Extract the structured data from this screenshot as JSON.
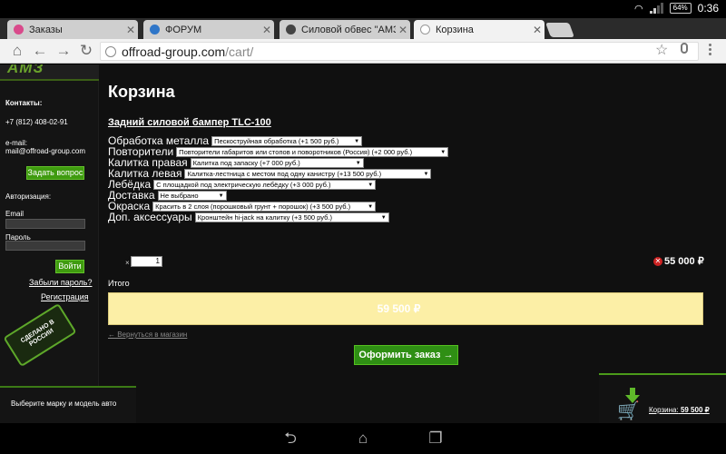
{
  "status": {
    "battery": "64%",
    "time": "0:36"
  },
  "tabs": [
    {
      "label": "Заказы",
      "icon": "tab-favicon-orders-icon",
      "color": "#d94a8b"
    },
    {
      "label": "ФОРУМ",
      "icon": "tab-favicon-forum-icon",
      "color": "#2f76c8"
    },
    {
      "label": "Силовой обвес \"АМЗ\"",
      "icon": "tab-favicon-amz-icon",
      "color": "#444444"
    },
    {
      "label": "Корзина",
      "icon": "globe-icon",
      "color": "#999999"
    }
  ],
  "toolbar": {
    "url_host": "offroad-group.com",
    "url_path": "/cart/"
  },
  "sidebar": {
    "contacts_heading": "Контакты:",
    "phone": "+7 (812) 408-02-91",
    "email_label": "e-mail:",
    "email": "mail@offroad-group.com",
    "ask_button": "Задать вопрос",
    "auth_heading": "Авторизация:",
    "email_field_label": "Email",
    "password_field_label": "Пароль",
    "login_button": "Войти",
    "forgot_link": "Забыли пароль?",
    "register_link": "Регистрация",
    "badge": "СДЕЛАНО В РОССИИ",
    "logo": "АМЗ"
  },
  "cart": {
    "title": "Корзина",
    "product": "Задний силовой бампер TLC-100",
    "options": [
      {
        "label": "Обработка металла",
        "value": "Пескоструйная обработка (+1 500 руб.)"
      },
      {
        "label": "Повторители",
        "value": "Повторители габаритов или стопов и поворотников (Россия) (+2 000 руб.)"
      },
      {
        "label": "Калитка правая",
        "value": "Калитка под запаску (+7 000 руб.)"
      },
      {
        "label": "Калитка левая",
        "value": "Калитка-лестница с местом под одну канистру (+13 500 руб.)"
      },
      {
        "label": "Лебёдка",
        "value": "С площадкой под электрическую лебёдку (+3 000 руб.)"
      },
      {
        "label": "Доставка",
        "value": "Не выбрано"
      },
      {
        "label": "Окраска",
        "value": "Красить в 2 слоя (порошковый грунт + порошок) (+3 500 руб.)"
      },
      {
        "label": "Доп. аксессуары",
        "value": "Кронштейн hi-jack на калитку (+3 500 руб.)"
      }
    ],
    "qty_prefix": "×",
    "qty": "1",
    "line_total": "55 000 ₽",
    "total_label": "Итого",
    "total": "59 500 ₽",
    "back_link": "← Вернуться в магазин",
    "checkout_button": "Оформить заказ →"
  },
  "footer": {
    "choose_car": "Выберите марку и модель авто",
    "cart_prefix": "Корзина:",
    "cart_total": "59 500 ₽"
  }
}
